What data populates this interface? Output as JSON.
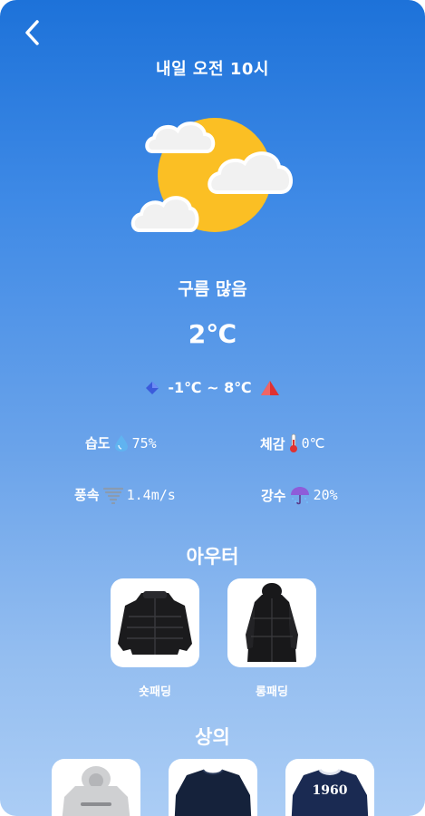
{
  "header": {
    "back_icon": "chevron-left-icon",
    "time_label": "내일 오전 10시"
  },
  "weather": {
    "icon": "partly-cloudy-sun-icon",
    "condition": "구름 많음",
    "temperature": "2℃",
    "range": {
      "min_icon": "blue-diamond-icon",
      "text": "-1℃ ~ 8℃",
      "max_icon": "red-triangle-icon"
    }
  },
  "stats": {
    "humidity": {
      "label": "습도",
      "icon": "droplet-icon",
      "value": "75%"
    },
    "feels_like": {
      "label": "체감",
      "icon": "thermometer-icon",
      "value": "0℃"
    },
    "wind": {
      "label": "풍속",
      "icon": "tornado-icon",
      "value": "1.4m/s"
    },
    "precipitation": {
      "label": "강수",
      "icon": "umbrella-rain-icon",
      "value": "20%"
    }
  },
  "outerwear": {
    "title": "아우터",
    "items": [
      {
        "label": "숏패딩",
        "image": "short-padding-jacket"
      },
      {
        "label": "롱패딩",
        "image": "long-padding-coat"
      }
    ]
  },
  "tops": {
    "title": "상의",
    "items": [
      {
        "label": "",
        "image": "gray-hoodie",
        "print": ""
      },
      {
        "label": "",
        "image": "navy-sweatshirt",
        "print": ""
      },
      {
        "label": "",
        "image": "navy-print-sweatshirt",
        "print": "1960"
      }
    ]
  },
  "colors": {
    "gradient_top": "#1d72d9",
    "gradient_bottom": "#abcdf5",
    "sun": "#fbbf24",
    "cloud": "#f1f1f1"
  }
}
